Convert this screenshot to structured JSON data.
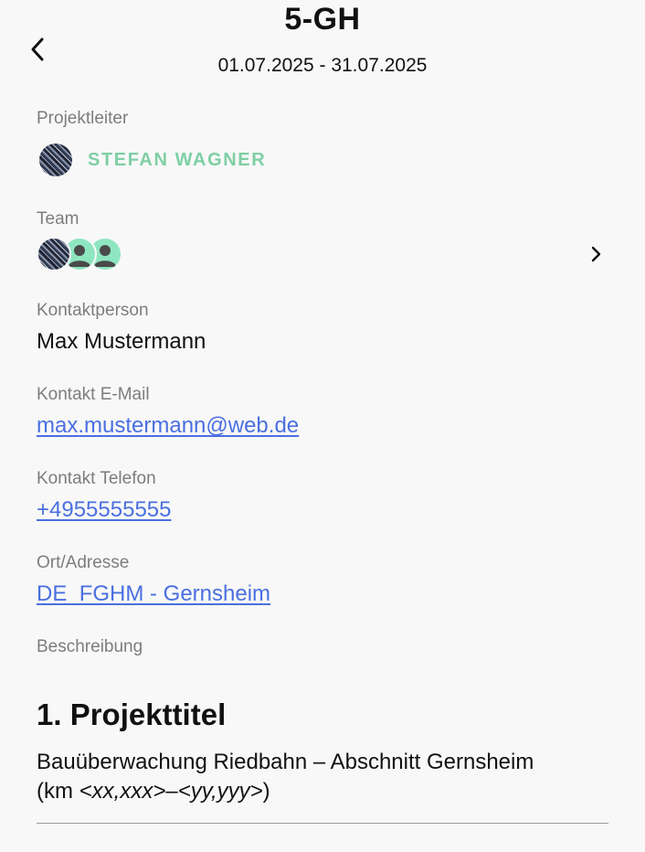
{
  "header": {
    "title": "5-GH",
    "date_range": "01.07.2025 - 31.07.2025"
  },
  "project_leader": {
    "label": "Projektleiter",
    "name": "STEFAN WAGNER",
    "name_color": "#7fcfa4"
  },
  "team": {
    "label": "Team",
    "member_avatars": [
      "photo",
      "person",
      "person"
    ]
  },
  "contact_person": {
    "label": "Kontaktperson",
    "value": "Max Mustermann"
  },
  "contact_email": {
    "label": "Kontakt E-Mail",
    "value": "max.mustermann@web.de"
  },
  "contact_phone": {
    "label": "Kontakt Telefon",
    "value": "+4955555555"
  },
  "location": {
    "label": "Ort/Adresse",
    "value": "DE_FGHM - Gernsheim"
  },
  "description": {
    "label": "Beschreibung",
    "heading": "1. Projekttitel",
    "text_main": "Bauüberwachung Riedbahn – Abschnitt Gernsheim",
    "text_prefix": "(km ",
    "text_from": "<xx,xxx>",
    "text_dash": "–",
    "text_to": "<yy,yyy>",
    "text_suffix": ")"
  },
  "colors": {
    "link": "#4a6fe0",
    "label": "#7d7d7d",
    "background": "#f8f8f8",
    "avatar_person": "#8ee6c0"
  }
}
